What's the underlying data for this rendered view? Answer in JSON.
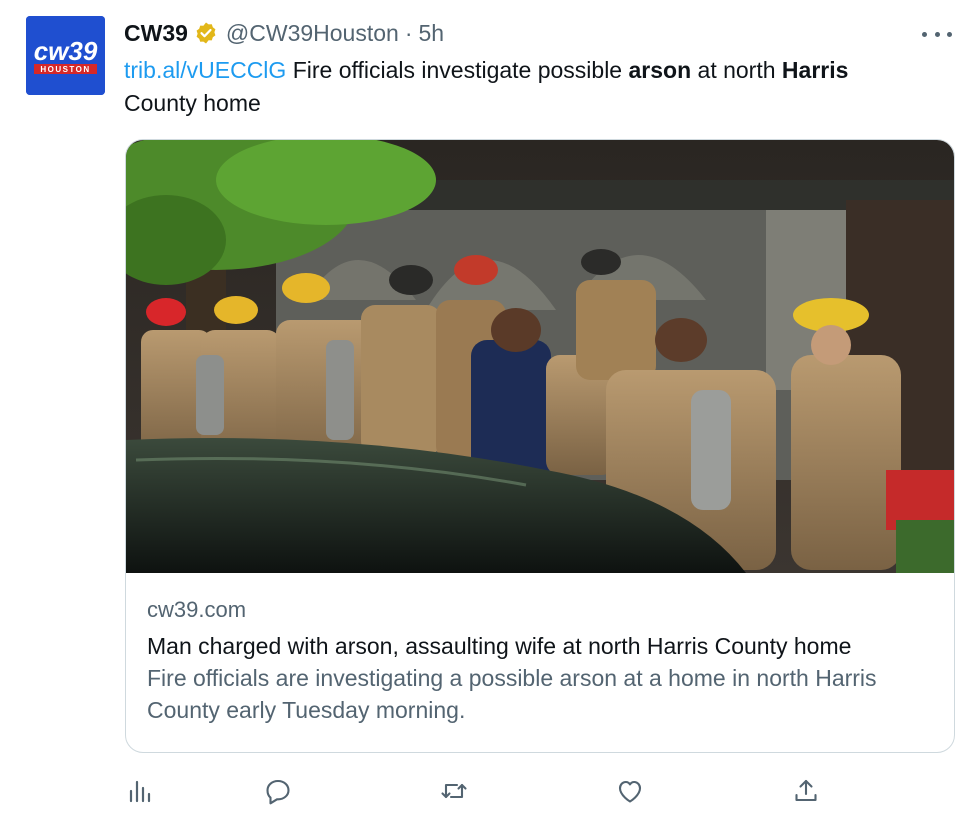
{
  "account": {
    "display_name": "CW39",
    "handle": "@CW39Houston",
    "separator": "·",
    "time": "5h",
    "avatar_text_main": "cw39",
    "avatar_text_sub": "HOUSTON",
    "verified": true
  },
  "tweet": {
    "link_text": "trib.al/vUECClG",
    "text_part1": " Fire officials investigate possible ",
    "bold1": "arson",
    "text_part2": " at north ",
    "bold2": "Harris",
    "text_part3": " County home"
  },
  "card": {
    "image_alt": "Firefighters in gear gathered outside a house at night",
    "domain": "cw39.com",
    "title": "Man charged with arson, assaulting wife at north Harris County home",
    "description": "Fire officials are investigating a possible arson at a home in north Harris County early Tuesday morning."
  },
  "actions": [
    {
      "name": "analytics-icon"
    },
    {
      "name": "reply-icon"
    },
    {
      "name": "retweet-icon"
    },
    {
      "name": "like-icon"
    },
    {
      "name": "share-icon"
    }
  ],
  "colors": {
    "link": "#1d9bf0",
    "secondary_text": "#536471",
    "verified_gold": "#e2b719",
    "avatar_bg": "#1f4fd0",
    "card_border": "#cfd9de"
  }
}
